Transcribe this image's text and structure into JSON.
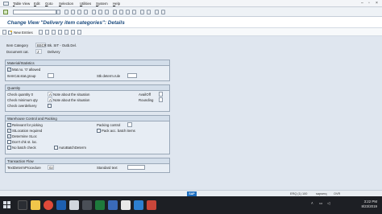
{
  "menu": {
    "items": [
      {
        "first": "T",
        "rest": "able View"
      },
      {
        "first": "E",
        "rest": "dit"
      },
      {
        "first": "G",
        "rest": "oto"
      },
      {
        "first": "S",
        "rest": "election"
      },
      {
        "first": "U",
        "rest": "tilities"
      },
      {
        "first": "S",
        "rest": "ystem"
      },
      {
        "first": "H",
        "rest": "elp"
      }
    ]
  },
  "page_title": "Change View \"Delivery item categories\": Details",
  "app_toolbar": {
    "new_entries": "New Entries"
  },
  "header": {
    "item_category_label": "Item Category",
    "item_category_code": "BSCR",
    "item_category_desc": "Bk. SIT - Outb.Del.",
    "document_cat_label": "Document cat.",
    "document_cat_code": "J",
    "document_cat_desc": "Delivery"
  },
  "material_statistics": {
    "title": "Material/Statistics",
    "mat_no_allowed_label": "Mat.no. '0' allowed",
    "mat_no_allowed_checked": true,
    "itemcat_stat_group_label": "ItemCat.stat.group",
    "stk_determ_rule_label": "Stk determ.rule"
  },
  "quantity": {
    "title": "Quantity",
    "check_quantity_0_label": "Check quantity 0",
    "check_quantity_0_code": "A",
    "check_quantity_0_text": "Note about the situation",
    "check_minimum_qty_label": "Check minimum qty",
    "check_minimum_qty_code": "A",
    "check_minimum_qty_text": "Note about the situation",
    "check_overdelivery_label": "Check overdelivery",
    "availoff_label": "AvailOff",
    "rounding_label": "Rounding"
  },
  "warehouse": {
    "title": "Warehouse Control and Packing",
    "relevant_for_picking": "Relevant for picking",
    "relevant_for_picking_checked": true,
    "packing_control_label": "Packing control",
    "sloc_required": "StLocation required",
    "sloc_required_checked": true,
    "pack_acc_batch_items": "Pack acc. batch items",
    "determine_sloc": "Determine SLoc",
    "determine_sloc_checked": true,
    "dont_chk_st_loc": "Don't chk st. loc.",
    "no_batch_check": "No batch check",
    "auto_batch_determ": "AutoBatchDeterm"
  },
  "transaction_flow": {
    "title": "Transaction Flow",
    "text_determ_procedure_label": "TextDetermProcedure",
    "text_determ_procedure_value": "02",
    "standard_text_label": "Standard text"
  },
  "status_bar": {
    "sap_logo": "SAP",
    "system": "ERQ (1) 100",
    "server": "sapserq",
    "mode": "OVR"
  },
  "taskbar": {
    "time": "3:22 PM",
    "date": "8/23/2019"
  }
}
